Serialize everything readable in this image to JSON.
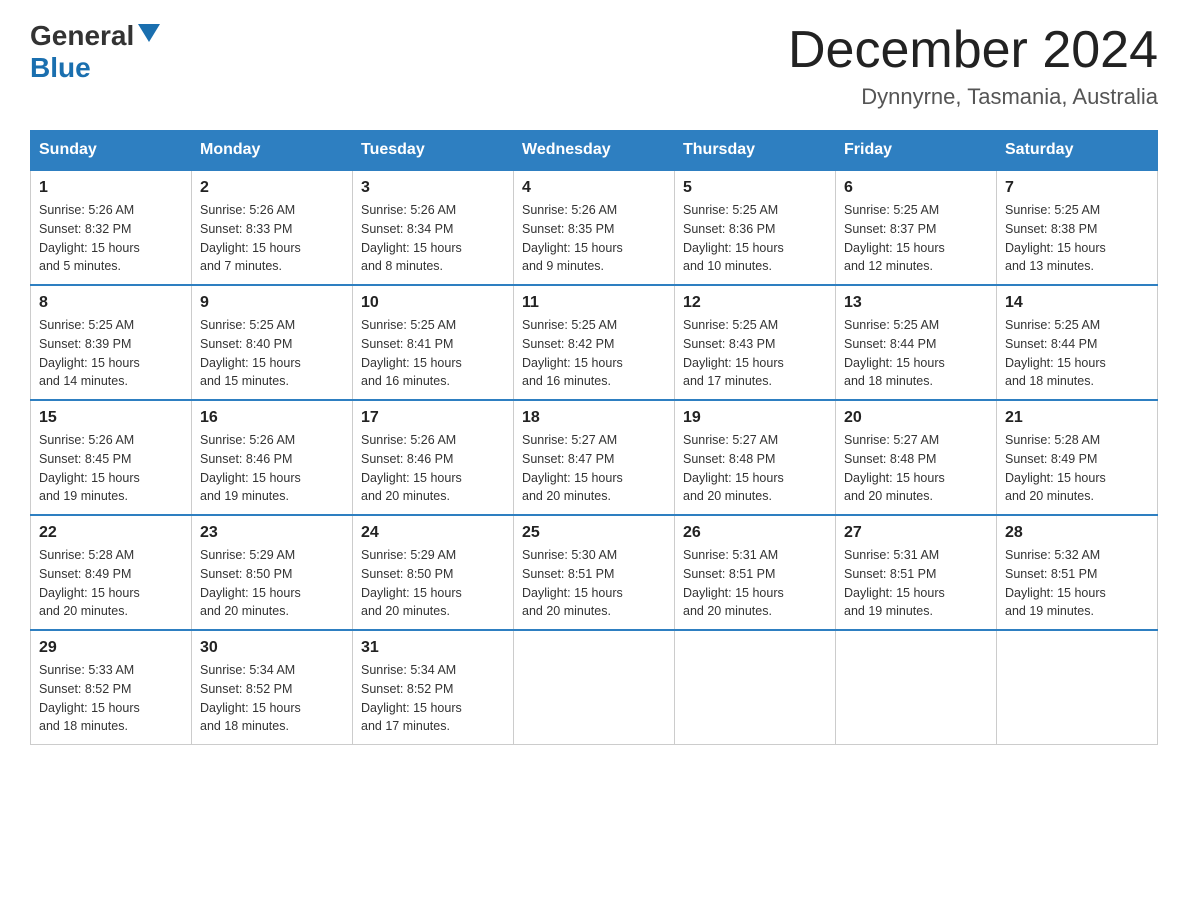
{
  "header": {
    "logo_general": "General",
    "logo_blue": "Blue",
    "title": "December 2024",
    "location": "Dynnyrne, Tasmania, Australia"
  },
  "days_of_week": [
    "Sunday",
    "Monday",
    "Tuesday",
    "Wednesday",
    "Thursday",
    "Friday",
    "Saturday"
  ],
  "weeks": [
    [
      {
        "day": "1",
        "sunrise": "5:26 AM",
        "sunset": "8:32 PM",
        "daylight": "15 hours and 5 minutes."
      },
      {
        "day": "2",
        "sunrise": "5:26 AM",
        "sunset": "8:33 PM",
        "daylight": "15 hours and 7 minutes."
      },
      {
        "day": "3",
        "sunrise": "5:26 AM",
        "sunset": "8:34 PM",
        "daylight": "15 hours and 8 minutes."
      },
      {
        "day": "4",
        "sunrise": "5:26 AM",
        "sunset": "8:35 PM",
        "daylight": "15 hours and 9 minutes."
      },
      {
        "day": "5",
        "sunrise": "5:25 AM",
        "sunset": "8:36 PM",
        "daylight": "15 hours and 10 minutes."
      },
      {
        "day": "6",
        "sunrise": "5:25 AM",
        "sunset": "8:37 PM",
        "daylight": "15 hours and 12 minutes."
      },
      {
        "day": "7",
        "sunrise": "5:25 AM",
        "sunset": "8:38 PM",
        "daylight": "15 hours and 13 minutes."
      }
    ],
    [
      {
        "day": "8",
        "sunrise": "5:25 AM",
        "sunset": "8:39 PM",
        "daylight": "15 hours and 14 minutes."
      },
      {
        "day": "9",
        "sunrise": "5:25 AM",
        "sunset": "8:40 PM",
        "daylight": "15 hours and 15 minutes."
      },
      {
        "day": "10",
        "sunrise": "5:25 AM",
        "sunset": "8:41 PM",
        "daylight": "15 hours and 16 minutes."
      },
      {
        "day": "11",
        "sunrise": "5:25 AM",
        "sunset": "8:42 PM",
        "daylight": "15 hours and 16 minutes."
      },
      {
        "day": "12",
        "sunrise": "5:25 AM",
        "sunset": "8:43 PM",
        "daylight": "15 hours and 17 minutes."
      },
      {
        "day": "13",
        "sunrise": "5:25 AM",
        "sunset": "8:44 PM",
        "daylight": "15 hours and 18 minutes."
      },
      {
        "day": "14",
        "sunrise": "5:25 AM",
        "sunset": "8:44 PM",
        "daylight": "15 hours and 18 minutes."
      }
    ],
    [
      {
        "day": "15",
        "sunrise": "5:26 AM",
        "sunset": "8:45 PM",
        "daylight": "15 hours and 19 minutes."
      },
      {
        "day": "16",
        "sunrise": "5:26 AM",
        "sunset": "8:46 PM",
        "daylight": "15 hours and 19 minutes."
      },
      {
        "day": "17",
        "sunrise": "5:26 AM",
        "sunset": "8:46 PM",
        "daylight": "15 hours and 20 minutes."
      },
      {
        "day": "18",
        "sunrise": "5:27 AM",
        "sunset": "8:47 PM",
        "daylight": "15 hours and 20 minutes."
      },
      {
        "day": "19",
        "sunrise": "5:27 AM",
        "sunset": "8:48 PM",
        "daylight": "15 hours and 20 minutes."
      },
      {
        "day": "20",
        "sunrise": "5:27 AM",
        "sunset": "8:48 PM",
        "daylight": "15 hours and 20 minutes."
      },
      {
        "day": "21",
        "sunrise": "5:28 AM",
        "sunset": "8:49 PM",
        "daylight": "15 hours and 20 minutes."
      }
    ],
    [
      {
        "day": "22",
        "sunrise": "5:28 AM",
        "sunset": "8:49 PM",
        "daylight": "15 hours and 20 minutes."
      },
      {
        "day": "23",
        "sunrise": "5:29 AM",
        "sunset": "8:50 PM",
        "daylight": "15 hours and 20 minutes."
      },
      {
        "day": "24",
        "sunrise": "5:29 AM",
        "sunset": "8:50 PM",
        "daylight": "15 hours and 20 minutes."
      },
      {
        "day": "25",
        "sunrise": "5:30 AM",
        "sunset": "8:51 PM",
        "daylight": "15 hours and 20 minutes."
      },
      {
        "day": "26",
        "sunrise": "5:31 AM",
        "sunset": "8:51 PM",
        "daylight": "15 hours and 20 minutes."
      },
      {
        "day": "27",
        "sunrise": "5:31 AM",
        "sunset": "8:51 PM",
        "daylight": "15 hours and 19 minutes."
      },
      {
        "day": "28",
        "sunrise": "5:32 AM",
        "sunset": "8:51 PM",
        "daylight": "15 hours and 19 minutes."
      }
    ],
    [
      {
        "day": "29",
        "sunrise": "5:33 AM",
        "sunset": "8:52 PM",
        "daylight": "15 hours and 18 minutes."
      },
      {
        "day": "30",
        "sunrise": "5:34 AM",
        "sunset": "8:52 PM",
        "daylight": "15 hours and 18 minutes."
      },
      {
        "day": "31",
        "sunrise": "5:34 AM",
        "sunset": "8:52 PM",
        "daylight": "15 hours and 17 minutes."
      },
      null,
      null,
      null,
      null
    ]
  ]
}
